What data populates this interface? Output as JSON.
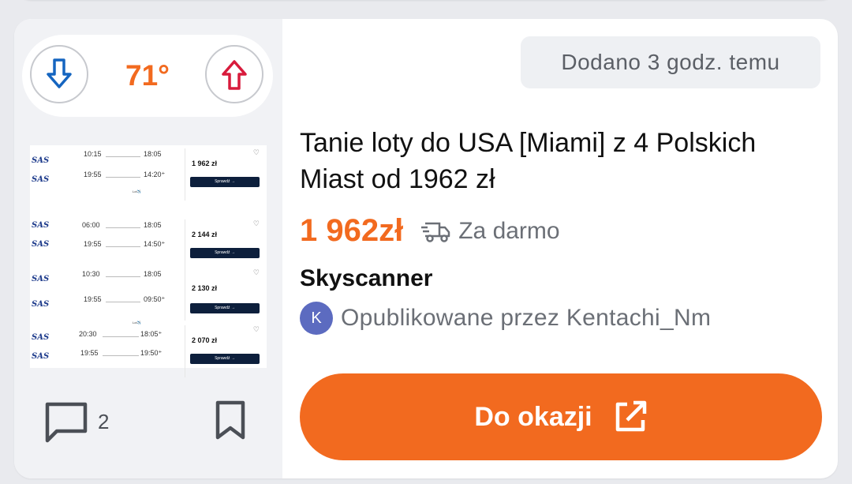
{
  "vote": {
    "temperature": "71°"
  },
  "deal": {
    "added": "Dodano 3 godz. temu",
    "title": "Tanie loty do USA [Miami] z 4 Polskich Miast od 1962 zł",
    "price": "1 962zł",
    "shipping": "Za darmo",
    "merchant": "Skyscanner",
    "poster_initial": "K",
    "poster_text": "Opublikowane przez Kentachi_Nm",
    "cta_label": "Do okazji",
    "comment_count": "2"
  },
  "thumbnail": {
    "airline": "SAS",
    "brand": "Lot✈️",
    "check_label": "Sprawdź →",
    "rows": [
      {
        "dep1": "10:15",
        "arr1": "18:05",
        "dep2": "19:55",
        "arr2": "14:20⁺",
        "price": "1 962 zł"
      },
      {
        "dep1": "06:00",
        "arr1": "18:05",
        "dep2": "19:55",
        "arr2": "14:50⁺",
        "price": "2 144 zł"
      },
      {
        "dep1": "10:30",
        "arr1": "18:05",
        "dep2": "19:55",
        "arr2": "09:50⁺",
        "price": "2 130 zł"
      },
      {
        "dep1": "20:30",
        "arr1": "18:05⁺",
        "dep2": "19:55",
        "arr2": "19:50⁺",
        "price": "2 070 zł"
      }
    ]
  },
  "colors": {
    "accent": "#f26a1f",
    "down": "#1565c0",
    "up": "#d81b3c",
    "avatar": "#5c6bc0"
  },
  "icons": [
    "arrow-down-icon",
    "arrow-up-icon",
    "comment-icon",
    "bookmark-icon",
    "truck-icon",
    "external-link-icon"
  ]
}
